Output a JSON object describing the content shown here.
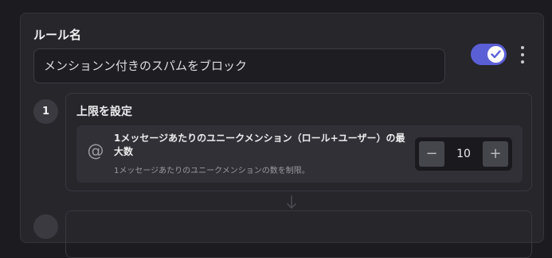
{
  "rule": {
    "name_label": "ルール名",
    "name_value": "メンションン付きのスパムをブロック",
    "enabled": true
  },
  "step": {
    "number": "1",
    "title": "上限を設定",
    "setting": {
      "icon": "at-icon",
      "title": "1メッセージあたりのユニークメンション（ロール+ユーザー）の最大数",
      "description": "1メッセージあたりのユニークメンションの数を制限。",
      "value": "10",
      "decrement_label": "−",
      "increment_label": "+"
    }
  },
  "colors": {
    "accent": "#5b5fd6",
    "panel": "#26262b",
    "background": "#1c1c20"
  }
}
